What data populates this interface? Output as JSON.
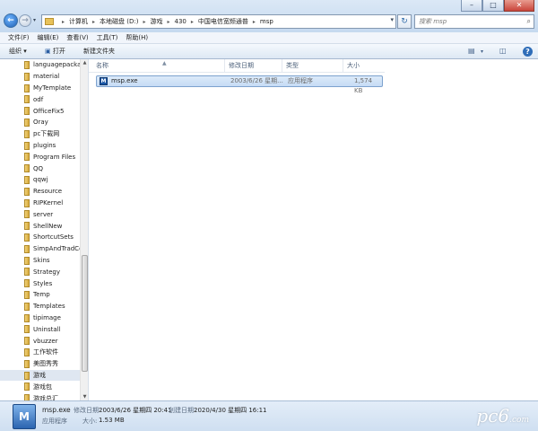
{
  "address": {
    "crumbs": [
      "计算机",
      "本地磁盘 (D:)",
      "游戏",
      "430",
      "中国电信宽频通普",
      "msp"
    ],
    "search_placeholder": "搜索 msp"
  },
  "window": {
    "minimize": "–",
    "maximize": "□",
    "close": "✕"
  },
  "menu": [
    "文件(F)",
    "编辑(E)",
    "查看(V)",
    "工具(T)",
    "帮助(H)"
  ],
  "toolbar": {
    "organize": "组织 ▾",
    "open": "打开",
    "new_folder": "新建文件夹"
  },
  "nav_items": [
    "languagepacka",
    "material",
    "MyTemplate",
    "odf",
    "OfficeFix5",
    "Oray",
    "pc下载网",
    "plugins",
    "Program Files",
    "QQ",
    "qqwj",
    "Resource",
    "RIPKernel",
    "server",
    "ShellNew",
    "ShortcutSets",
    "SimpAndTradCo",
    "Skins",
    "Strategy",
    "Styles",
    "Temp",
    "Templates",
    "tipimage",
    "Uninstall",
    "vbuzzer",
    "工作软件",
    "美图秀秀",
    "游戏",
    "游戏包",
    "游戏总汇"
  ],
  "nav_selected_index": 27,
  "columns": {
    "name": "名称",
    "date": "修改日期",
    "type": "类型",
    "size": "大小"
  },
  "file": {
    "name": "msp.exe",
    "date": "2003/6/26 星期...",
    "type": "应用程序",
    "size": "1,574 KB"
  },
  "details": {
    "name": "msp.exe",
    "modified_label": "修改日期:",
    "modified": "2003/6/26 星期四 20:41",
    "created_label": "创建日期:",
    "created": "2020/4/30 星期四 16:11",
    "type": "应用程序",
    "size_label": "大小:",
    "size": "1.53 MB"
  },
  "watermark": {
    "main": "pc6",
    "suffix": ".com"
  }
}
